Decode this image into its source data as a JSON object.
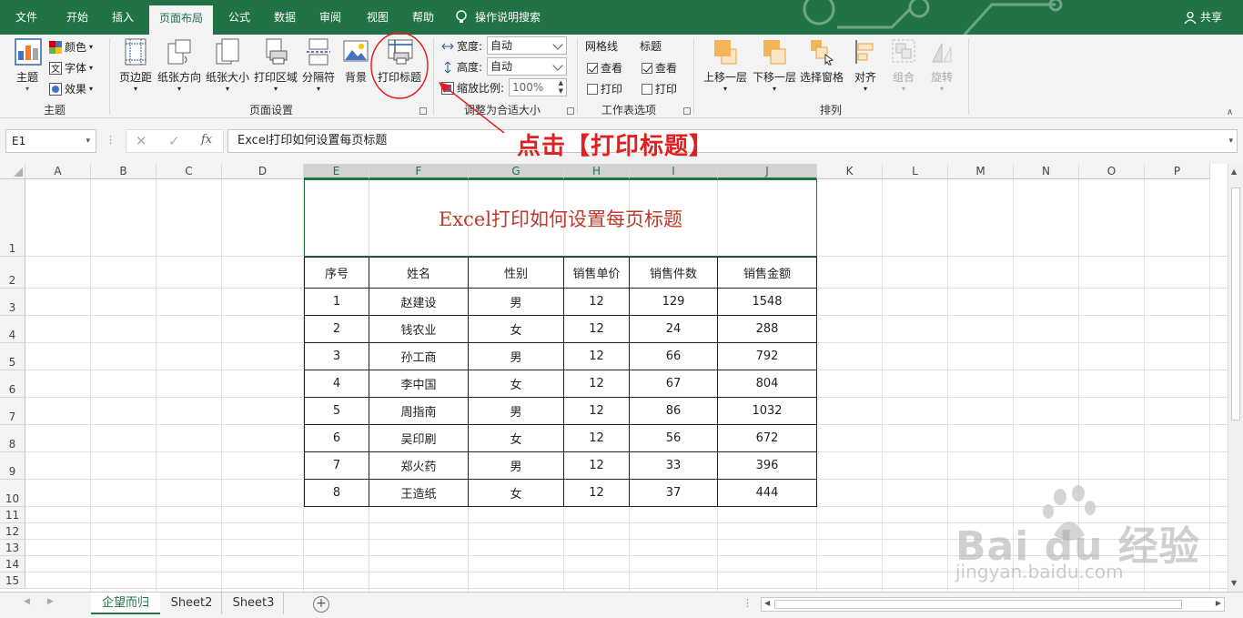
{
  "tabs": [
    "文件",
    "开始",
    "插入",
    "页面布局",
    "公式",
    "数据",
    "审阅",
    "视图",
    "帮助"
  ],
  "tell_me": "操作说明搜索",
  "share": "共享",
  "groups": {
    "theme": {
      "label": "主题",
      "theme_btn": "主题",
      "colors": "颜色",
      "fonts": "字体",
      "effects": "效果"
    },
    "page_setup": {
      "label": "页面设置",
      "margins": "页边距",
      "orientation": "纸张方向",
      "size": "纸张大小",
      "print_area": "打印区域",
      "breaks": "分隔符",
      "background": "背景",
      "print_titles": "打印标题"
    },
    "scale": {
      "label": "调整为合适大小",
      "width_label": "宽度:",
      "width_value": "自动",
      "height_label": "高度:",
      "height_value": "自动",
      "scale_label": "缩放比例:",
      "scale_value": "100%"
    },
    "sheet_options": {
      "label": "工作表选项",
      "gridlines": "网格线",
      "headings": "标题",
      "view": "查看",
      "print": "打印"
    },
    "arrange": {
      "label": "排列",
      "bring_forward": "上移一层",
      "send_backward": "下移一层",
      "selection_pane": "选择窗格",
      "align": "对齐",
      "group": "组合",
      "rotate": "旋转"
    }
  },
  "name_box": "E1",
  "formula": "Excel打印如何设置每页标题",
  "annotation": "点击【打印标题】",
  "columns": [
    "A",
    "B",
    "C",
    "D",
    "E",
    "F",
    "G",
    "H",
    "I",
    "J",
    "K",
    "L",
    "M",
    "N",
    "O",
    "P"
  ],
  "rows": [
    "1",
    "2",
    "3",
    "4",
    "5",
    "6",
    "7",
    "8",
    "9",
    "10",
    "11",
    "12",
    "13",
    "14",
    "15"
  ],
  "sheet_title": "Excel打印如何设置每页标题",
  "table": {
    "headers": [
      "序号",
      "姓名",
      "性别",
      "销售单价",
      "销售件数",
      "销售金额"
    ],
    "rows": [
      [
        "1",
        "赵建设",
        "男",
        "12",
        "129",
        "1548"
      ],
      [
        "2",
        "钱农业",
        "女",
        "12",
        "24",
        "288"
      ],
      [
        "3",
        "孙工商",
        "男",
        "12",
        "66",
        "792"
      ],
      [
        "4",
        "李中国",
        "女",
        "12",
        "67",
        "804"
      ],
      [
        "5",
        "周指南",
        "男",
        "12",
        "86",
        "1032"
      ],
      [
        "6",
        "吴印刷",
        "女",
        "12",
        "56",
        "672"
      ],
      [
        "7",
        "郑火药",
        "男",
        "12",
        "33",
        "396"
      ],
      [
        "8",
        "王造纸",
        "女",
        "12",
        "37",
        "444"
      ]
    ]
  },
  "sheets": [
    "企望而归",
    "Sheet2",
    "Sheet3"
  ],
  "watermark": {
    "brand": "Bai du 经验",
    "url": "jingyan.baidu.com"
  },
  "colors": {
    "accent": "#217346",
    "annotation": "#e02020",
    "title_text": "#c0392b"
  }
}
